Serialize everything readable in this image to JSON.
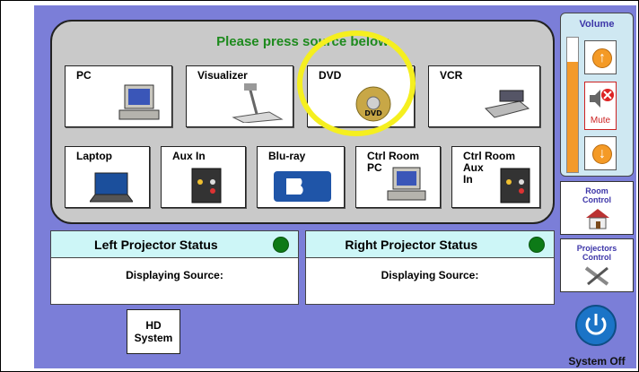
{
  "sources": {
    "title": "Please press source below",
    "buttons": [
      {
        "label": "PC"
      },
      {
        "label": "Visualizer"
      },
      {
        "label": "DVD"
      },
      {
        "label": "VCR"
      },
      {
        "label": "Laptop"
      },
      {
        "label": "Aux In"
      },
      {
        "label": "Blu-ray"
      },
      {
        "label": "Ctrl Room\nPC"
      },
      {
        "label": "Ctrl Room\nAux\nIn"
      }
    ]
  },
  "left_projector": {
    "title": "Left Projector Status",
    "displaying": "Displaying Source:"
  },
  "right_projector": {
    "title": "Right Projector Status",
    "displaying": "Displaying Source:"
  },
  "hd_system": {
    "label": "HD\nSystem"
  },
  "volume": {
    "title": "Volume",
    "level": 0.82,
    "mute_label": "Mute"
  },
  "room_control": {
    "label": "Room\nControl"
  },
  "projectors_control": {
    "label": "Projectors\nControl"
  },
  "system_off": {
    "label": "System Off"
  },
  "colors": {
    "panel": "#7b7ed8",
    "status_on": "#0d7a17",
    "highlight": "#f5ef1f"
  }
}
